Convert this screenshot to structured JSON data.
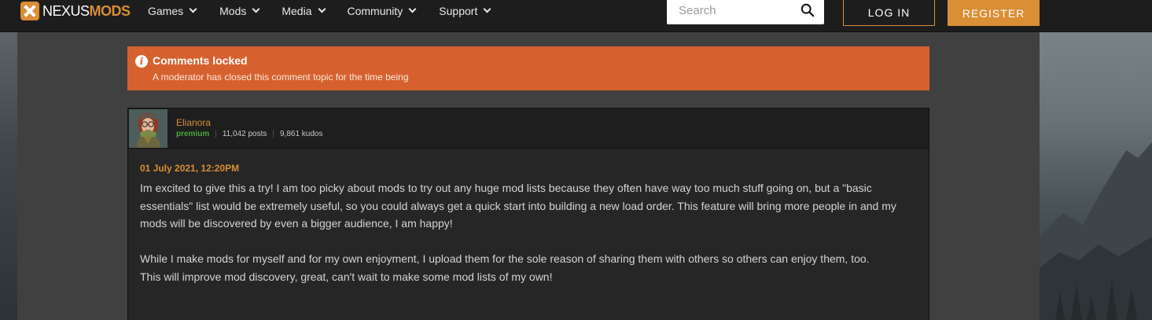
{
  "navbar": {
    "logo": {
      "part1": "NEXUS",
      "part2": "MODS"
    },
    "menu": [
      {
        "label": "Games"
      },
      {
        "label": "Mods"
      },
      {
        "label": "Media"
      },
      {
        "label": "Community"
      },
      {
        "label": "Support"
      }
    ],
    "search": {
      "placeholder": "Search"
    },
    "login_label": "LOG IN",
    "register_label": "REGISTER"
  },
  "alert": {
    "title": "Comments locked",
    "text": "A moderator has closed this comment topic for the time being",
    "icon": "info-icon",
    "color": "#d6612e"
  },
  "comment": {
    "author": "Elianora",
    "membership": "premium",
    "posts": "11,042 posts",
    "kudos": "9,861 kudos",
    "date": "01 July 2021, 12:20PM",
    "paragraphs": [
      "Im excited to give this a try! I am too picky about mods to try out any huge mod lists because they often have way too much stuff going on, but a \"basic essentials\" list would be extremely useful, so you could always get a quick start into building a new load order. This feature will bring more people in and my mods will be discovered by even a bigger audience, I am happy!",
      "While I make mods for myself and for my own enjoyment, I upload them for the sole reason of sharing them with others so others can enjoy them, too.",
      "This will improve mod discovery, great, can't wait to make some mod lists of my own!"
    ]
  },
  "colors": {
    "accent": "#da8e35",
    "premium": "#4aa83a"
  }
}
